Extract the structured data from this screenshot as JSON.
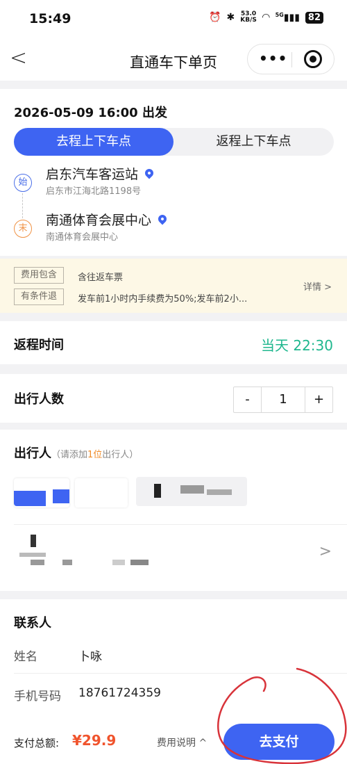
{
  "status_bar": {
    "time": "15:49",
    "net_speed": "53.0",
    "net_unit": "KB/S",
    "signal": "5G",
    "battery": "82"
  },
  "nav": {
    "title": "直通车下单页"
  },
  "trip": {
    "departure": "2026-05-09 16:00 出发",
    "tabs": [
      "去程上下车点",
      "返程上下车点"
    ],
    "start_badge": "始",
    "start_name": "启东汽车客运站",
    "start_addr": "启东市江海北路1198号",
    "end_badge": "末",
    "end_name": "南通体育会展中心",
    "end_addr": "南通体育会展中心"
  },
  "notice": {
    "tag1": "费用包含",
    "text1": "含往返车票",
    "tag2": "有条件退",
    "text2": "发车前1小时内手续费为50%;发车前2小...",
    "detail": "详情 >"
  },
  "return_row": {
    "label": "返程时间",
    "value": "当天 22:30"
  },
  "count_row": {
    "label": "出行人数",
    "minus": "-",
    "count": "1",
    "plus": "+"
  },
  "passengers": {
    "label": "出行人",
    "hint_prefix": "（请添加",
    "hint_num": "1位",
    "hint_suffix": "出行人）",
    "chevron": ">"
  },
  "contact": {
    "label": "联系人",
    "name_label": "姓名",
    "name_value": "卜咏",
    "phone_label": "手机号码",
    "phone_value": "18761724359"
  },
  "bottom": {
    "total_label": "支付总额:",
    "total_amount": "¥29.9",
    "fee_link": "费用说明 ^",
    "pay": "去支付"
  },
  "colors": {
    "primary": "#3e64f2",
    "green": "#1fb78e",
    "price": "#f0542d",
    "annotation": "#d8333a"
  }
}
